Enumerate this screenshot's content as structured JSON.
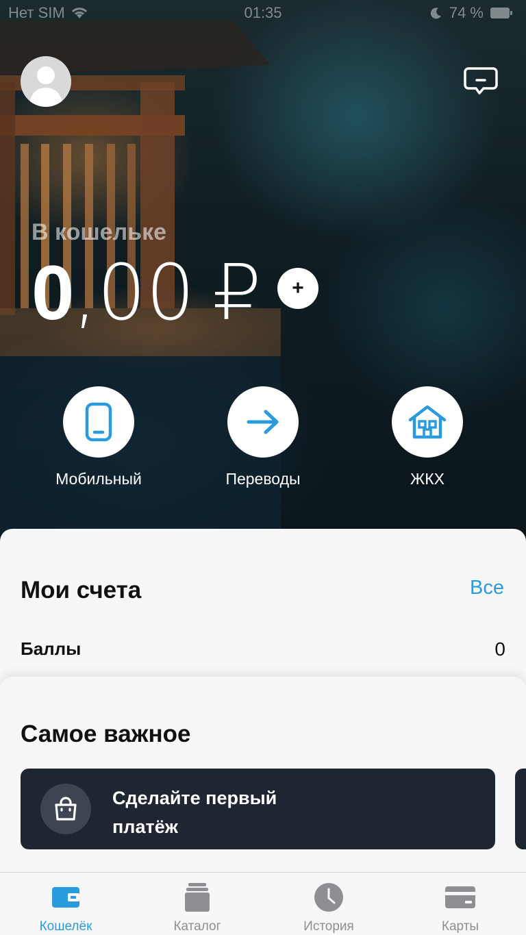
{
  "status_bar": {
    "carrier": "Нет SIM",
    "time": "01:35",
    "battery": "74 %",
    "icons": [
      "wifi-icon",
      "moon-icon",
      "battery-icon"
    ]
  },
  "header": {
    "avatar_icon": "user-avatar-icon",
    "chat_icon": "chat-bubble-icon"
  },
  "wallet": {
    "label": "В кошельке",
    "amount_integer": "0",
    "amount_fraction": ",00",
    "currency": "₽",
    "topup_label": "+"
  },
  "actions": [
    {
      "label": "Мобильный",
      "icon": "mobile-phone-icon"
    },
    {
      "label": "Переводы",
      "icon": "arrow-right-icon"
    },
    {
      "label": "ЖКХ",
      "icon": "house-icon"
    }
  ],
  "accounts": {
    "title": "Мои счета",
    "all_link": "Все",
    "rows": [
      {
        "label": "Баллы",
        "value": "0"
      }
    ]
  },
  "important": {
    "title": "Самое важное",
    "card_text": "Сделайте первый платёж",
    "card_icon": "shopping-bag-icon"
  },
  "tabbar": {
    "active_color": "#2a9bdc",
    "inactive_color": "#8e8e93",
    "tabs": [
      {
        "label": "Кошелёк",
        "icon": "wallet-icon",
        "active": true
      },
      {
        "label": "Каталог",
        "icon": "catalog-icon",
        "active": false
      },
      {
        "label": "История",
        "icon": "clock-icon",
        "active": false
      },
      {
        "label": "Карты",
        "icon": "card-icon",
        "active": false
      }
    ]
  },
  "colors": {
    "accent": "#2a9bdc",
    "card_dark": "#1e2731",
    "sheet_bg": "#f7f7f8"
  }
}
